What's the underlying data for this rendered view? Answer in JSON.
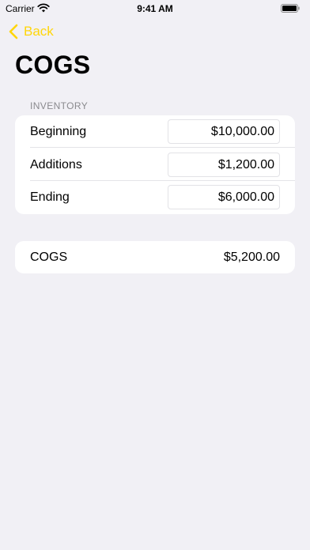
{
  "status_bar": {
    "carrier": "Carrier",
    "time": "9:41 AM"
  },
  "nav": {
    "back_label": "Back"
  },
  "page": {
    "title": "COGS"
  },
  "inventory": {
    "header": "INVENTORY",
    "rows": [
      {
        "label": "Beginning",
        "value": "$10,000.00"
      },
      {
        "label": "Additions",
        "value": "$1,200.00"
      },
      {
        "label": "Ending",
        "value": "$6,000.00"
      }
    ]
  },
  "summary": {
    "label": "COGS",
    "value": "$5,200.00"
  },
  "colors": {
    "accent": "#ffd60a",
    "background": "#f1f0f5",
    "card": "#ffffff"
  }
}
